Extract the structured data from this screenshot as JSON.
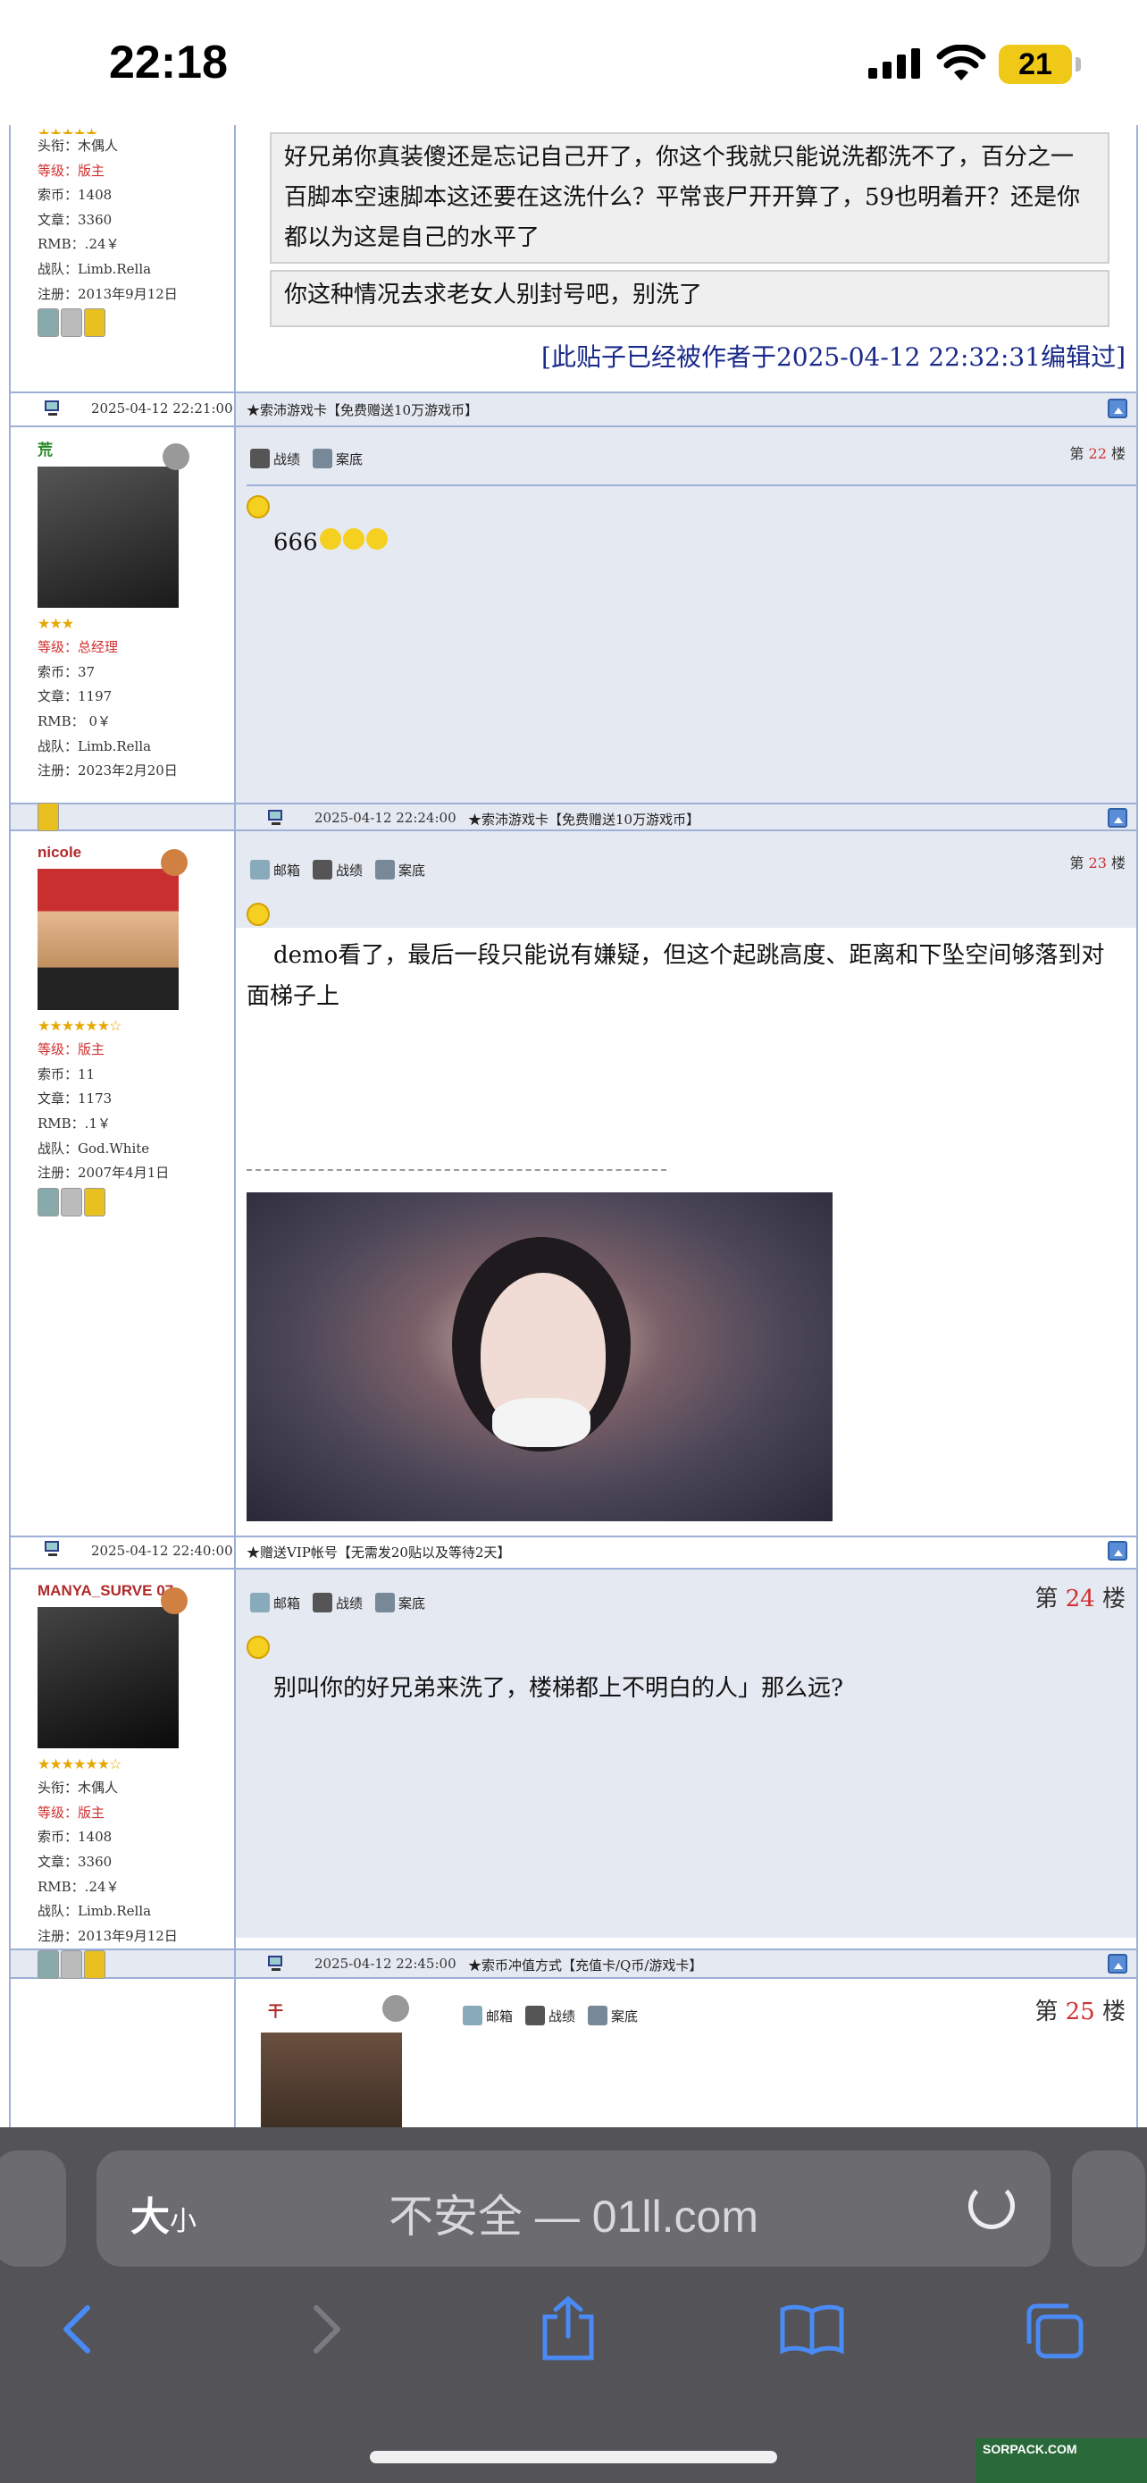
{
  "status_bar": {
    "time": "22:18",
    "battery": "21"
  },
  "post_top": {
    "user": {
      "title": "头衔：木偶人",
      "level": "等级：版主",
      "suo": "索币：1408",
      "articles": "文章：3360",
      "rmb": "RMB：.24￥",
      "team": "战队：Limb.Rella",
      "reg": "注册：2013年9月12日"
    },
    "quote1": "好兄弟你真装傻还是忘记自己开了，你这个我就只能说洗都洗不了，百分之一百脚本空速脚本这还要在这洗什么？平常丧尸开开算了，59也明着开？还是你都以为这是自己的水平了",
    "quote2": "你这种情况去求老女人别封号吧，别洗了",
    "edited": "[此贴子已经被作者于2025-04-12 22:32:31编辑过]",
    "datetime": "2025-04-12 22:21:00",
    "ad": "★索沛游戏卡【免费赠送10万游戏币】"
  },
  "post22": {
    "nick": "荒",
    "user": {
      "level": "等级：总经理",
      "suo": "索币：37",
      "articles": "文章：1197",
      "rmb": "RMB： 0￥",
      "team": "战队：Limb.Rella",
      "reg": "注册：2023年2月20日"
    },
    "actions": [
      "战绩",
      "案底"
    ],
    "floor_prefix": "第",
    "floor_num": "22",
    "floor_suffix": "楼",
    "body": "666",
    "datetime": "2025-04-12 22:24:00",
    "ad": "★索沛游戏卡【免费赠送10万游戏币】"
  },
  "post23": {
    "nick": "nicole",
    "user": {
      "level": "等级：版主",
      "suo": "索币：11",
      "articles": "文章：1173",
      "rmb": "RMB：.1￥",
      "team": "战队：God.White",
      "reg": "注册：2007年4月1日"
    },
    "actions": [
      "邮箱",
      "战绩",
      "案底"
    ],
    "floor_prefix": "第",
    "floor_num": "23",
    "floor_suffix": "楼",
    "body": "demo看了，最后一段只能说有嫌疑，但这个起跳高度、距离和下坠空间够落到对面梯子上",
    "datetime": "2025-04-12 22:40:00",
    "ad": "★赠送VIP帐号【无需发20贴以及等待2天】"
  },
  "post24": {
    "nick": "MANYA_SURVE 07",
    "user": {
      "title": "头衔：木偶人",
      "level": "等级：版主",
      "suo": "索币：1408",
      "articles": "文章：3360",
      "rmb": "RMB：.24￥",
      "team": "战队：Limb.Rella",
      "reg": "注册：2013年9月12日"
    },
    "actions": [
      "邮箱",
      "战绩",
      "案底"
    ],
    "floor_prefix": "第",
    "floor_num": "24",
    "floor_suffix": "楼",
    "body": "别叫你的好兄弟来洗了，楼梯都上不明白的人」那么远?",
    "datetime": "2025-04-12 22:45:00",
    "ad": "★索币冲值方式【充值卡/Q币/游戏卡】"
  },
  "post25": {
    "nick": "干",
    "actions": [
      "邮箱",
      "战绩",
      "案底"
    ],
    "floor_prefix": "第",
    "floor_num": "25",
    "floor_suffix": "楼"
  },
  "browser": {
    "text_size_big": "大",
    "text_size_small": "小",
    "address": "不安全 — 01ll.com"
  },
  "colors": {
    "border": "#9db0d6",
    "band": "#e5e9f1",
    "floor_num": "#d03030",
    "edited": "#1a2a8a"
  }
}
